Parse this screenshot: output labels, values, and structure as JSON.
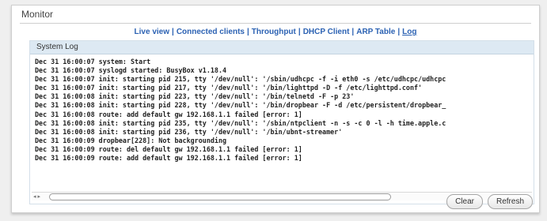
{
  "title": "Monitor",
  "nav": {
    "items": [
      "Live view",
      "Connected clients",
      "Throughput",
      "DHCP Client",
      "ARP Table",
      "Log"
    ],
    "separator": "|",
    "active": "Log"
  },
  "panel_title": "System Log",
  "log_lines": [
    "Dec 31 16:00:07 system: Start",
    "Dec 31 16:00:07 syslogd started: BusyBox v1.18.4",
    "Dec 31 16:00:07 init: starting pid 215, tty '/dev/null': '/sbin/udhcpc -f -i eth0 -s /etc/udhcpc/udhcpc",
    "Dec 31 16:00:07 init: starting pid 217, tty '/dev/null': '/bin/lighttpd -D -f /etc/lighttpd.conf'",
    "Dec 31 16:00:08 init: starting pid 223, tty '/dev/null': '/bin/telnetd -F -p 23'",
    "Dec 31 16:00:08 init: starting pid 228, tty '/dev/null': '/bin/dropbear -F -d /etc/persistent/dropbear_",
    "Dec 31 16:00:08 route: add default gw 192.168.1.1 failed [error: 1]",
    "Dec 31 16:00:08 init: starting pid 235, tty '/dev/null': '/sbin/ntpclient -n -s -c 0 -l -h time.apple.c",
    "Dec 31 16:00:08 init: starting pid 236, tty '/dev/null': '/bin/ubnt-streamer'",
    "Dec 31 16:00:09 dropbear[228]: Not backgrounding",
    "Dec 31 16:00:09 route: del default gw 192.168.1.1 failed [error: 1]",
    "Dec 31 16:00:09 route: add default gw 192.168.1.1 failed [error: 1]"
  ],
  "scrollbar": {
    "left_arrows": "◂ ▸",
    "right_arrows": "◂ ▸"
  },
  "buttons": {
    "clear": "Clear",
    "refresh": "Refresh"
  },
  "colors": {
    "nav_link": "#2c62b3",
    "panel_header_bg": "#dde9f3",
    "page_bg": "#efefef"
  }
}
